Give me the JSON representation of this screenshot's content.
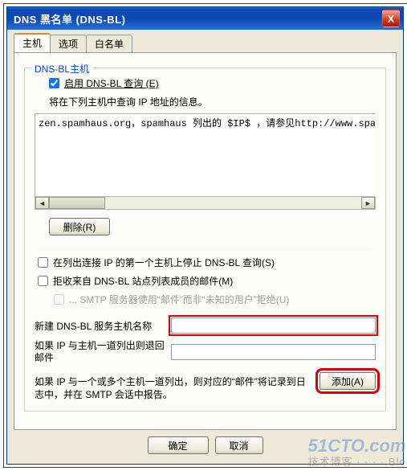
{
  "window": {
    "title": "DNS 黑名单 (DNS-BL)",
    "close_icon": "X"
  },
  "tabs": {
    "host": "主机",
    "options": "选项",
    "whitelist": "白名单"
  },
  "group": {
    "legend": "DNS-BL主机",
    "enable_label": "启用 DNS-BL 查询 (E)",
    "enable_checked": true,
    "lookup_hint": "将在下列主机中查询 IP 地址的信息。",
    "hosts_text": "zen.spamhaus.org，spamhaus 列出的 $IP$ ，请参见http://www.spa",
    "remove_label": "删除(R)",
    "stop_first_label": "在列出连接 IP 的第一个主机上停止 DNS-BL 查询(S)",
    "stop_first_checked": false,
    "reject_member_label": "拒收来自 DNS-BL 站点列表成员的邮件(M)",
    "reject_member_checked": false,
    "smtp_reject_label": "... SMTP 服务器使用“邮件”而非“未知的用户”拒绝(U)",
    "new_host_label": "新建 DNS-BL 服务主机名称",
    "new_host_value": "",
    "return_label": "如果 IP 与主机一道列出则退回邮件",
    "return_value": "",
    "log_note": "如果 IP 与一个或多个主机一道列出，则对应的“邮件”将记录到日志中，并在 SMTP 会话中报告。",
    "add_label": "添加(A)"
  },
  "buttons": {
    "ok": "确定",
    "cancel": "取消"
  },
  "watermark": {
    "brand": "51CTO.com",
    "sub": "技术博客 · · · · Blog"
  }
}
